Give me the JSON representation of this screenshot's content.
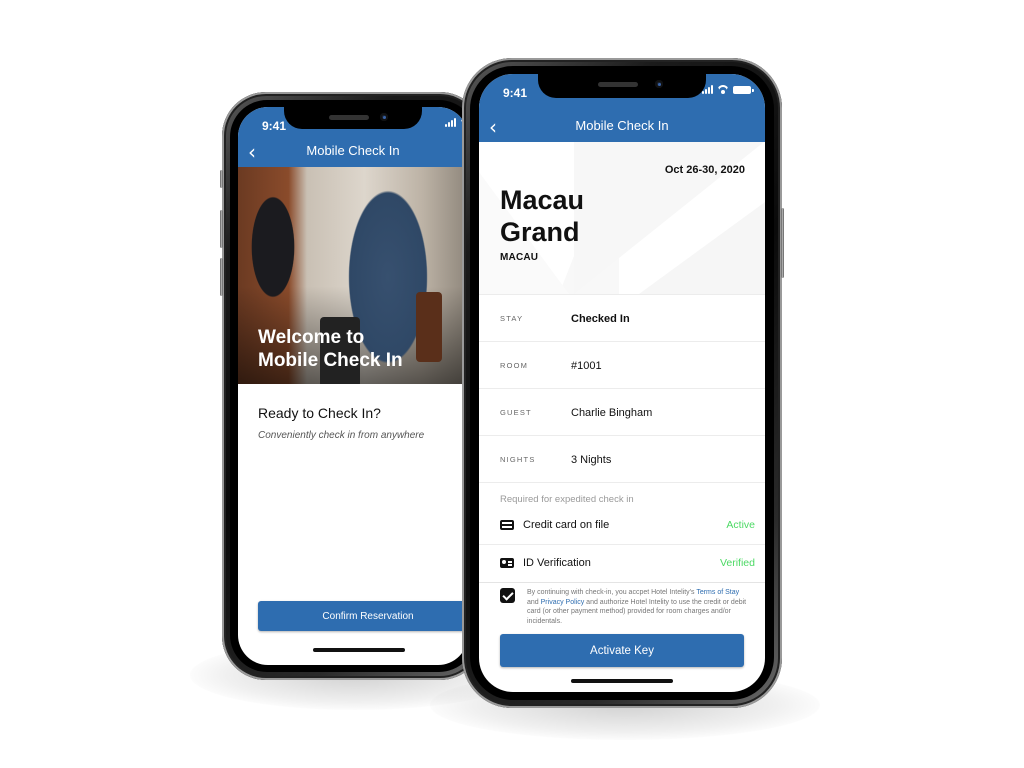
{
  "back_phone": {
    "status_time": "9:41",
    "nav_title": "Mobile Check In",
    "hero_title_line1": "Welcome to",
    "hero_title_line2": "Mobile Check In",
    "heading": "Ready to Check In?",
    "subtext": "Conveniently check in from anywhere",
    "confirm_label": "Confirm Reservation"
  },
  "front_phone": {
    "status_time": "9:41",
    "nav_title": "Mobile Check In",
    "dates": "Oct 26-30, 2020",
    "hotel_name_line1": "Macau",
    "hotel_name_line2": "Grand",
    "hotel_city": "MACAU",
    "details": [
      {
        "label": "STAY",
        "value": "Checked In"
      },
      {
        "label": "ROOM",
        "value": "#1001"
      },
      {
        "label": "GUEST",
        "value": "Charlie Bingham"
      },
      {
        "label": "NIGHTS",
        "value": "3 Nights"
      }
    ],
    "requirements_label": "Required for expedited check in",
    "requirements": [
      {
        "icon": "credit-card-icon",
        "label": "Credit card on file",
        "status": "Active"
      },
      {
        "icon": "id-card-icon",
        "label": "ID Verification",
        "status": "Verified"
      }
    ],
    "consent": {
      "checked": true,
      "text_1": "By continuing with check-in, you accpet Hotel Intelity's",
      "link_terms": "Terms of Stay",
      "text_2": "and",
      "link_privacy": "Privacy Policy",
      "text_3": "and authorize Hotel Intelity to use the credit or debit card (or other payment method) provided for room charges and/or incidentals."
    },
    "activate_label": "Activate Key"
  },
  "colors": {
    "brand_blue": "#2e6db0",
    "status_green": "#4cd964"
  }
}
